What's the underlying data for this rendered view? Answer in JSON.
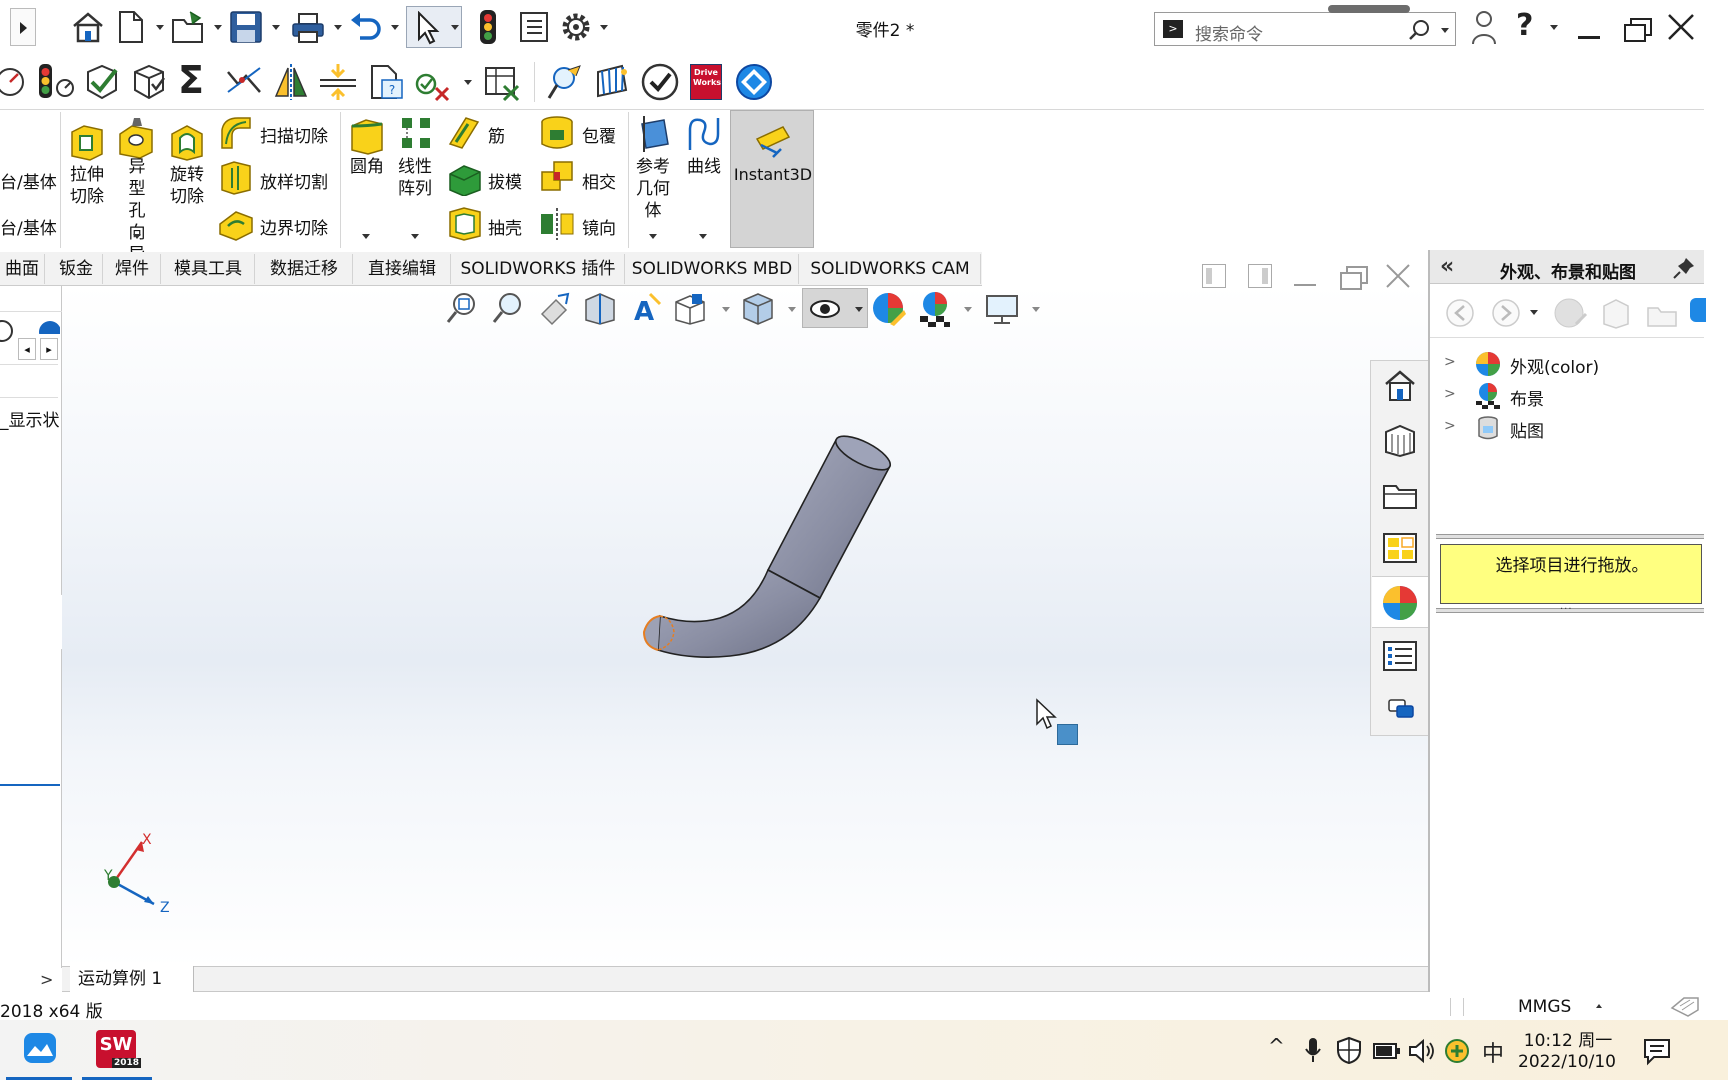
{
  "window": {
    "title": "零件2 *",
    "search_placeholder": "搜索命令",
    "help_label": "?"
  },
  "ribbon": {
    "left_labels": [
      "台/基体",
      "台/基体"
    ],
    "extrude_cut": "拉伸切除",
    "hole_wizard": "异型孔向导",
    "revolve_cut": "旋转切除",
    "sweep_cut": "扫描切除",
    "loft_cut": "放样切割",
    "boundary_cut": "边界切除",
    "fillet": "圆角",
    "linear_pattern": "线性阵列",
    "rib": "筋",
    "draft": "拔模",
    "shell": "抽壳",
    "wrap": "包覆",
    "intersect": "相交",
    "mirror": "镜向",
    "ref_geometry": "参考几何体",
    "curves": "曲线",
    "instant3d": "Instant3D"
  },
  "tabs": [
    "曲面",
    "钣金",
    "焊件",
    "模具工具",
    "数据迁移",
    "直接编辑",
    "SOLIDWORKS 插件",
    "SOLIDWORKS MBD",
    "SOLIDWORKS CAM"
  ],
  "left_panel": {
    "display_state": "_显示状态"
  },
  "triad": {
    "x": "X",
    "y": "Y",
    "z": "Z"
  },
  "bottom": {
    "motion_tab": "运动算例 1",
    "version": "2018 x64 版",
    "units": "MMGS"
  },
  "task_pane": {
    "title": "外观、布景和贴图",
    "tree": [
      "外观(color)",
      "布景",
      "贴图"
    ],
    "hint": "选择项目进行拖放。"
  },
  "taskbar": {
    "time": "10:12 周一",
    "date": "2022/10/10",
    "ime": "中",
    "sw_badge": "2018"
  },
  "colors": {
    "model": "#8a8ea3",
    "accent": "#1565c0",
    "hint_bg": "#ffff80",
    "sw_red": "#c8102e"
  }
}
